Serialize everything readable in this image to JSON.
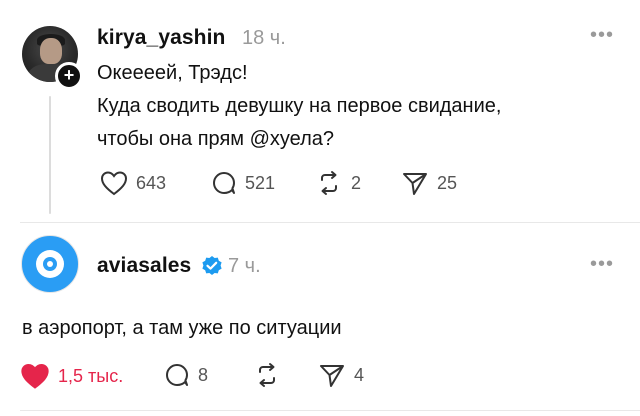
{
  "posts": [
    {
      "username": "kirya_yashin",
      "time": "18 ч.",
      "text_line1": "Океееей, Трэдс!",
      "text_line2": "Куда сводить девушку на первое свидание,",
      "text_line3": "чтобы она прям @хуела?",
      "likes": "643",
      "comments": "521",
      "reposts": "2",
      "shares": "25",
      "follow_badge": "+",
      "avatar_icon": "user-photo"
    },
    {
      "username": "aviasales",
      "time": "7 ч.",
      "verified": true,
      "text": "в аэропорт, а там уже по ситуации",
      "likes": "1,5 тыс.",
      "liked": true,
      "comments": "8",
      "reposts": "",
      "shares": "4",
      "avatar_icon": "aviasales-logo"
    }
  ],
  "more_icon": "•••",
  "colors": {
    "like_active": "#e5254b",
    "verified": "#1d9bf0",
    "muted": "#9a9a9a",
    "brand_blue": "#2a9df4"
  }
}
